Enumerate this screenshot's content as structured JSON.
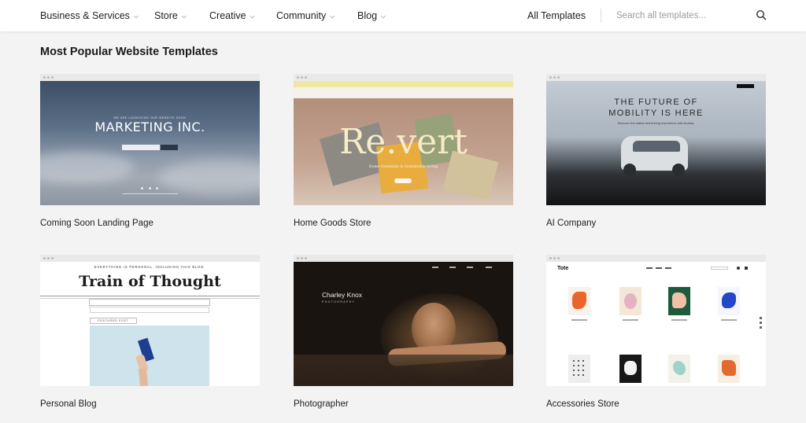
{
  "nav": {
    "items": [
      {
        "label": "Business & Services"
      },
      {
        "label": "Store"
      },
      {
        "label": "Creative"
      },
      {
        "label": "Community"
      },
      {
        "label": "Blog"
      }
    ],
    "all_templates": "All Templates",
    "search_placeholder": "Search all templates...",
    "search_icon": "search-icon"
  },
  "section_title": "Most Popular Website Templates",
  "colors": {
    "page_bg": "#f3f3f3",
    "nav_bg": "#ffffff",
    "text": "#222222"
  },
  "templates": [
    {
      "name": "Coming Soon Landing Page",
      "preview": {
        "kicker": "WE ARE LAUNCHING OUR WEBSITE SOON",
        "headline": "MARKETING INC."
      }
    },
    {
      "name": "Home Goods Store",
      "preview": {
        "headline": "Re.vert",
        "subline": "Home Essentials & Sustainable Living"
      }
    },
    {
      "name": "AI Company",
      "preview": {
        "headline_line1": "THE FUTURE OF",
        "headline_line2": "MOBILITY IS HERE",
        "subline": "Discover the safest self-driving experience with Autoba."
      }
    },
    {
      "name": "Personal Blog",
      "preview": {
        "kicker": "EVERYTHING IS PERSONAL. INCLUDING THIS BLOG.",
        "headline": "Train of Thought",
        "badge": "FEATURED POST"
      }
    },
    {
      "name": "Photographer",
      "preview": {
        "headline": "Charley Knox",
        "subline": "PHOTOGRAPHY"
      }
    },
    {
      "name": "Accessories Store",
      "preview": {
        "brand": "Tote"
      }
    }
  ]
}
